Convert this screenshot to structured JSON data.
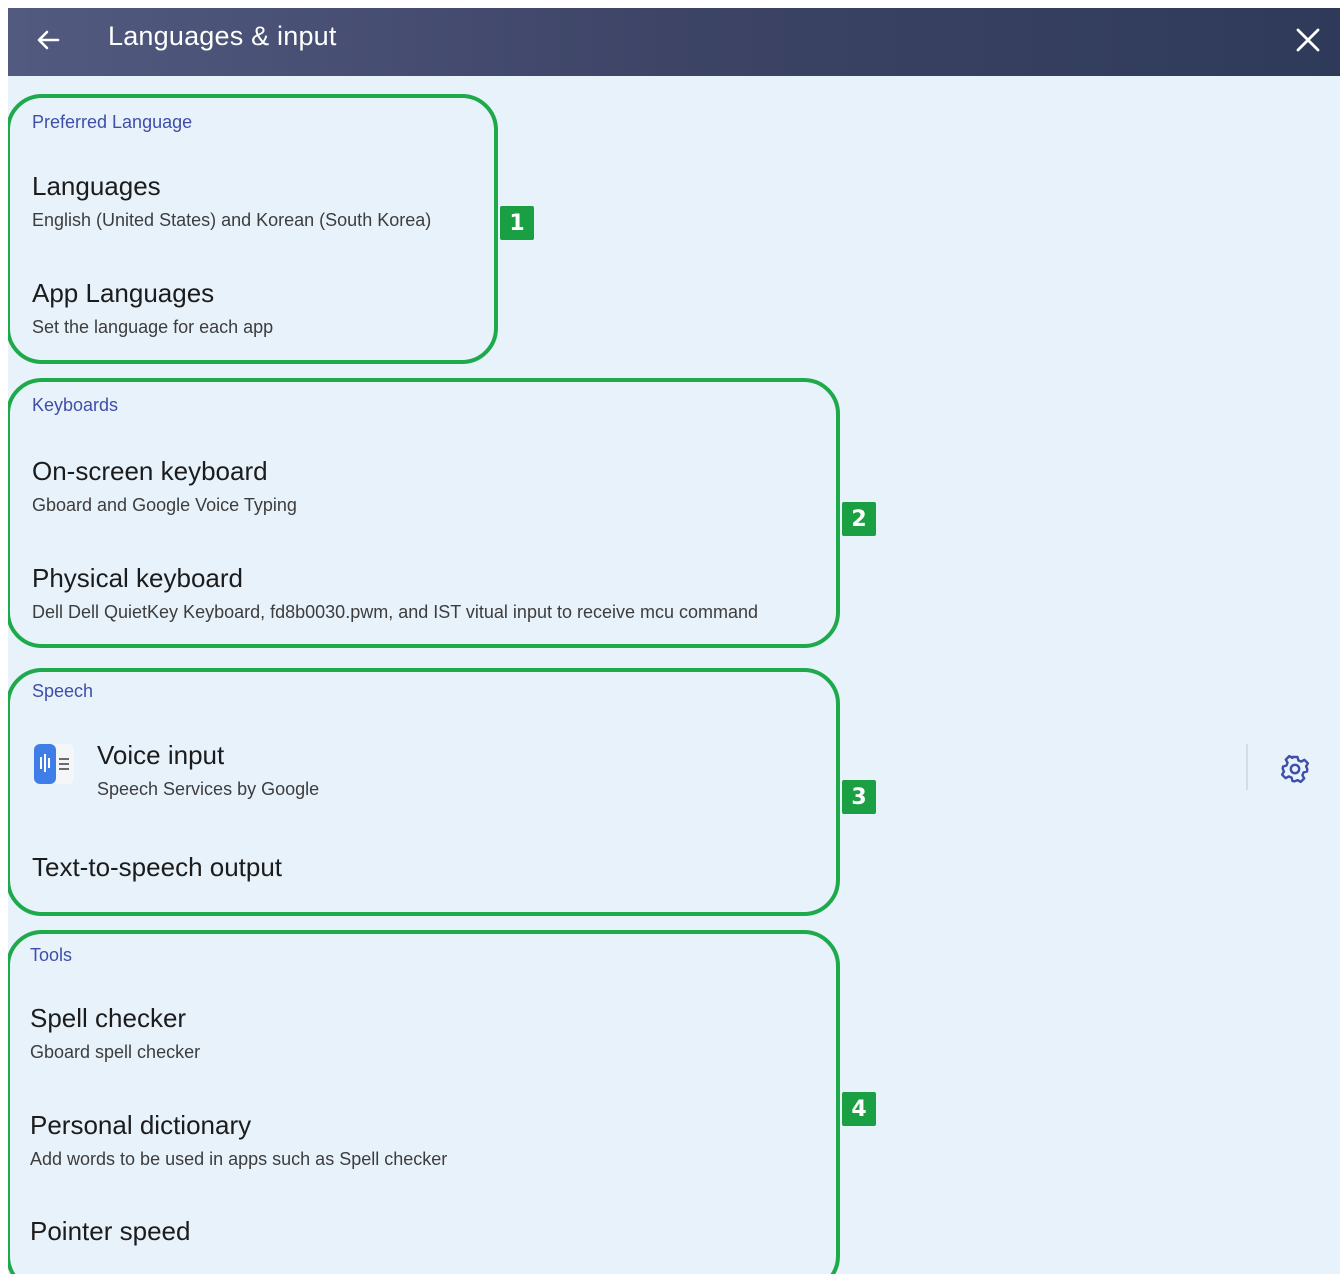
{
  "header": {
    "title": "Languages & input",
    "back_icon": "arrow-left-icon",
    "close_icon": "close-icon"
  },
  "sections": [
    {
      "badge": "1",
      "title": "Preferred Language",
      "items": [
        {
          "title": "Languages",
          "subtitle": "English (United States) and Korean (South Korea)"
        },
        {
          "title": "App Languages",
          "subtitle": "Set the language for each app"
        }
      ]
    },
    {
      "badge": "2",
      "title": "Keyboards",
      "items": [
        {
          "title": "On-screen keyboard",
          "subtitle": "Gboard and Google Voice Typing"
        },
        {
          "title": "Physical keyboard",
          "subtitle": "Dell Dell QuietKey Keyboard, fd8b0030.pwm, and IST vitual input to receive mcu command"
        }
      ]
    },
    {
      "badge": "3",
      "title": "Speech",
      "items": [
        {
          "title": "Voice input",
          "subtitle": "Speech Services by Google",
          "icon": "voice-input-app-icon",
          "action_icon": "gear-icon"
        },
        {
          "title": "Text-to-speech output"
        }
      ]
    },
    {
      "badge": "4",
      "title": "Tools",
      "items": [
        {
          "title": "Spell checker",
          "subtitle": "Gboard spell checker"
        },
        {
          "title": "Personal dictionary",
          "subtitle": "Add words to be used in apps such as Spell checker"
        },
        {
          "title": "Pointer speed"
        }
      ]
    }
  ],
  "colors": {
    "header_bg": "#3d4466",
    "page_bg": "#e8f2fb",
    "section_title": "#3f4ea8",
    "annotation_green": "#1eaa4b"
  }
}
